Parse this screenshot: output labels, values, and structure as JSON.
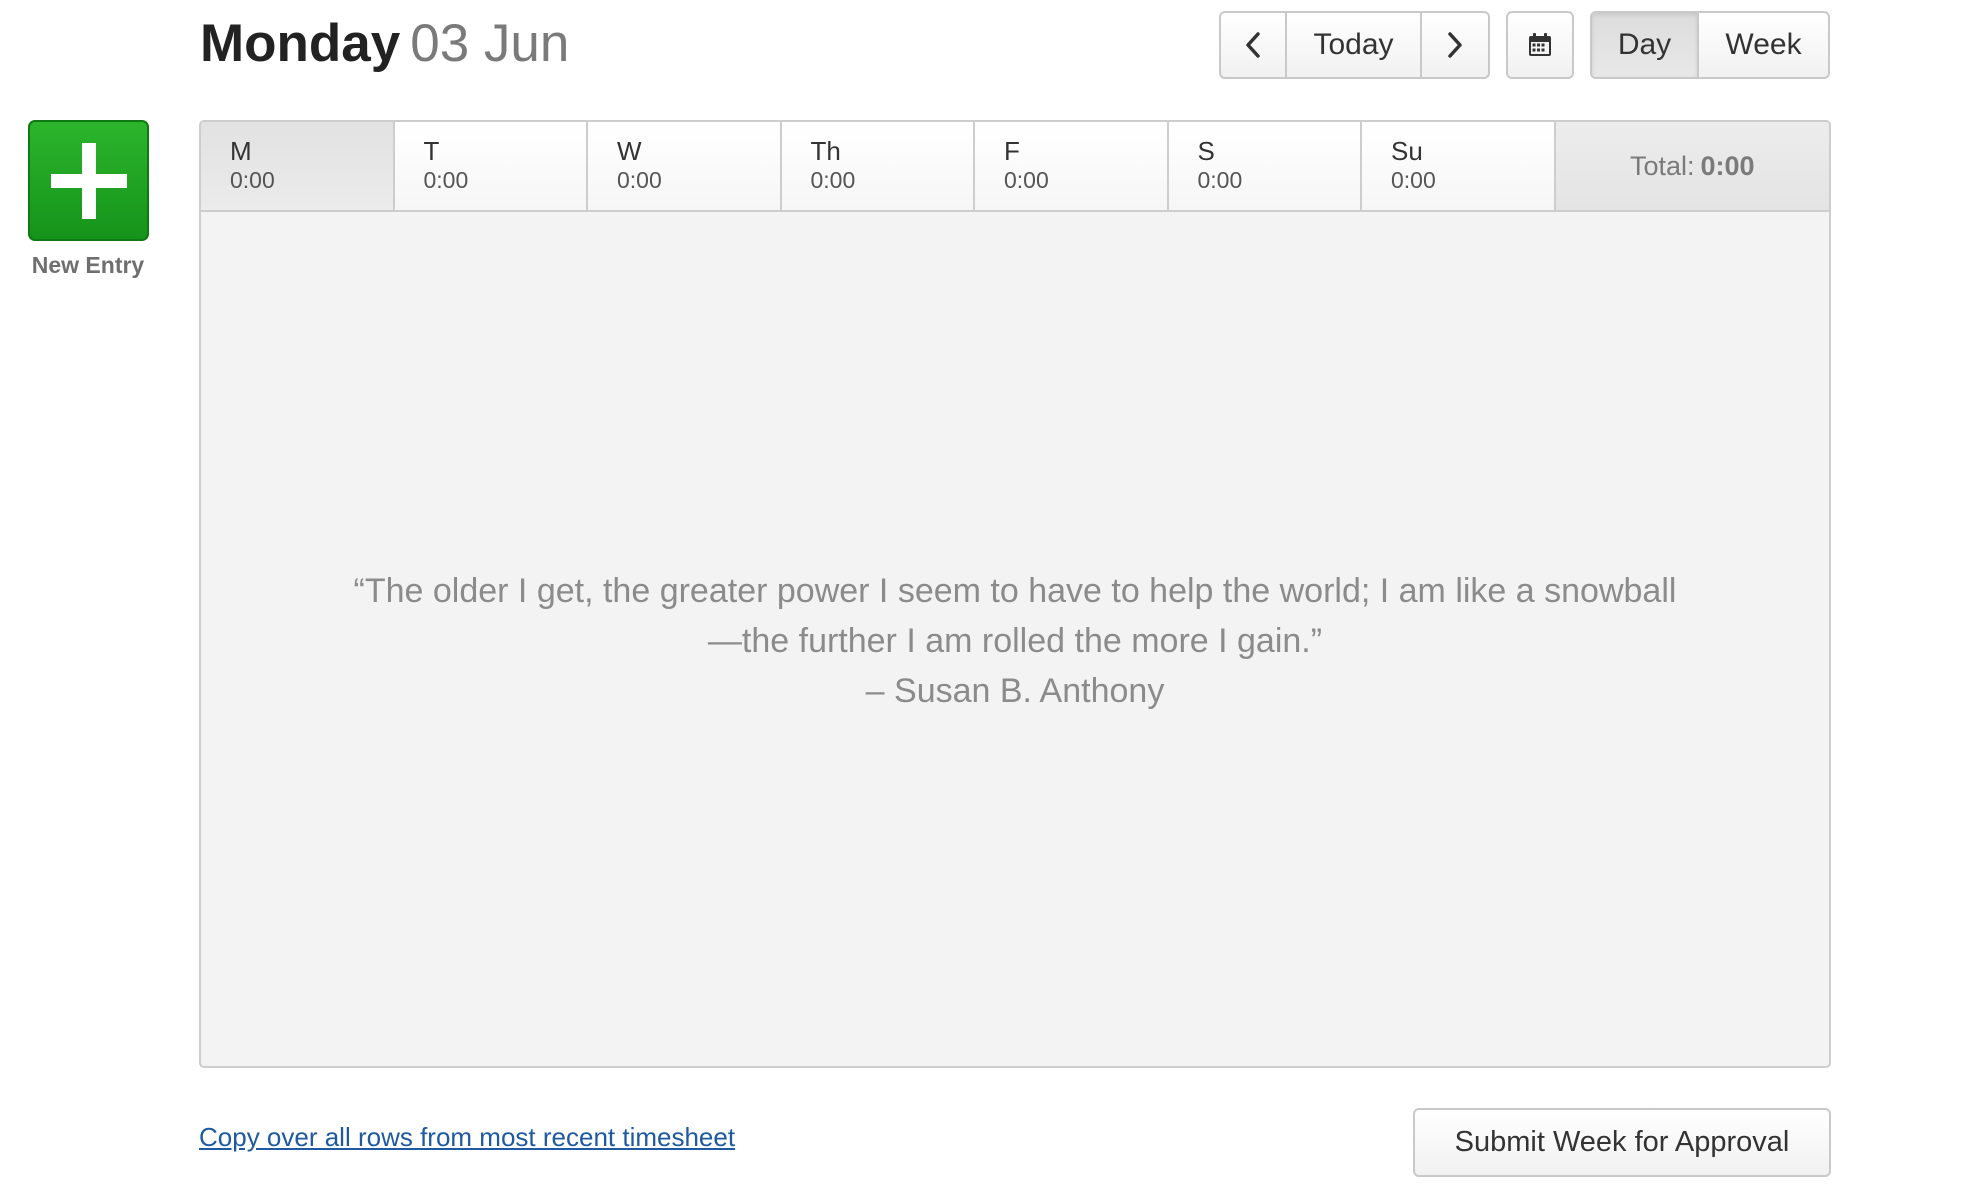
{
  "header": {
    "weekday": "Monday",
    "date": "03 Jun"
  },
  "nav": {
    "prev_icon": "chevron-left-icon",
    "today_label": "Today",
    "next_icon": "chevron-right-icon",
    "calendar_icon": "calendar-icon"
  },
  "view_toggle": {
    "day_label": "Day",
    "week_label": "Week",
    "active": "Day"
  },
  "new_entry": {
    "icon": "plus-icon",
    "label": "New Entry",
    "color": "#1ea51f"
  },
  "days": [
    {
      "letter": "M",
      "hours": "0:00"
    },
    {
      "letter": "T",
      "hours": "0:00"
    },
    {
      "letter": "W",
      "hours": "0:00"
    },
    {
      "letter": "Th",
      "hours": "0:00"
    },
    {
      "letter": "F",
      "hours": "0:00"
    },
    {
      "letter": "S",
      "hours": "0:00"
    },
    {
      "letter": "Su",
      "hours": "0:00"
    }
  ],
  "total": {
    "label": "Total:",
    "value": "0:00"
  },
  "quote": {
    "line1": "“The older I get, the greater power I seem to have to help the world; I am like a snowball",
    "line2": "—the further I am rolled the more I gain.”",
    "author": "– Susan B. Anthony"
  },
  "footer": {
    "copy_link": "Copy over all rows from most recent timesheet",
    "submit_label": "Submit Week for Approval",
    "link_color": "#1f5aa0"
  }
}
